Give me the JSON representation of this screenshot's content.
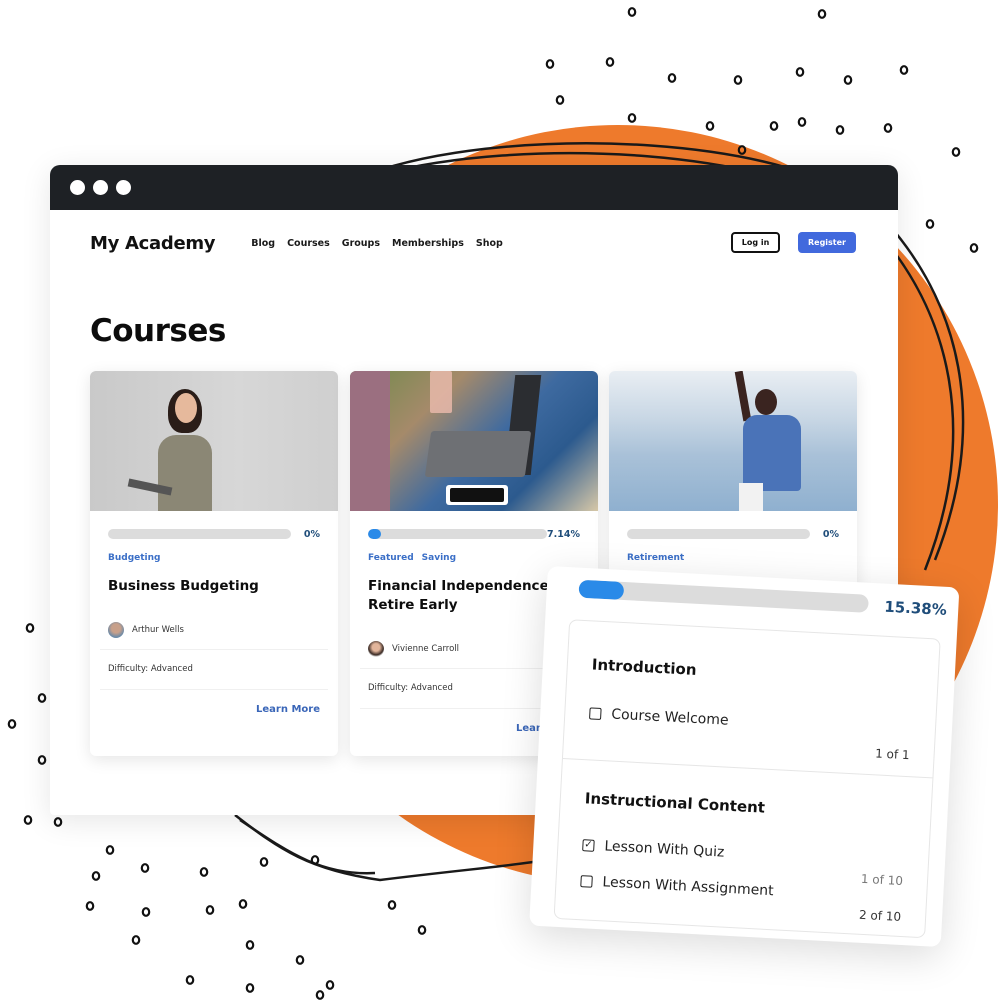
{
  "colors": {
    "accent_orange": "#ee7a2c",
    "titlebar": "#1e2125",
    "register_blue": "#4169dd",
    "progress_blue": "#2a8ae8",
    "percent_text": "#1f4d7a",
    "link_blue": "#3a66b8"
  },
  "window": {
    "controls": [
      "close",
      "minimize",
      "maximize"
    ]
  },
  "header": {
    "brand": "My Academy",
    "nav": [
      "Blog",
      "Courses",
      "Groups",
      "Memberships",
      "Shop"
    ],
    "login_label": "Log in",
    "register_label": "Register"
  },
  "main": {
    "title": "Courses",
    "courses": [
      {
        "image": "woman-with-tablet-photo",
        "progress_percent": 0,
        "progress_label": "0%",
        "tags": [
          "Budgeting"
        ],
        "title": "Business Budgeting",
        "author": "Arthur Wells",
        "difficulty": "Difficulty: Advanced",
        "cta": "Learn More"
      },
      {
        "image": "laptop-typing-photo",
        "progress_percent": 7.14,
        "progress_label": "7.14%",
        "tags": [
          "Featured",
          "Saving"
        ],
        "title": "Financial Independence Retire Early",
        "author": "Vivienne Carroll",
        "difficulty": "Difficulty: Advanced",
        "cta": "Learn More"
      },
      {
        "image": "woman-by-sea-photo",
        "progress_percent": 0,
        "progress_label": "0%",
        "tags": [
          "Retirement"
        ],
        "title": "",
        "author": "",
        "difficulty": "",
        "cta": ""
      }
    ]
  },
  "curriculum_panel": {
    "progress_percent": 15.38,
    "progress_label": "15.38%",
    "sections": [
      {
        "title": "Introduction",
        "lessons": [
          {
            "label": "Course Welcome",
            "checked": false,
            "count": "1 of 1"
          }
        ]
      },
      {
        "title": "Instructional Content",
        "lessons": [
          {
            "label": "Lesson With Quiz",
            "checked": true,
            "count": "1 of 10"
          },
          {
            "label": "Lesson With Assignment",
            "checked": false,
            "count": "2 of 10"
          }
        ]
      }
    ]
  }
}
